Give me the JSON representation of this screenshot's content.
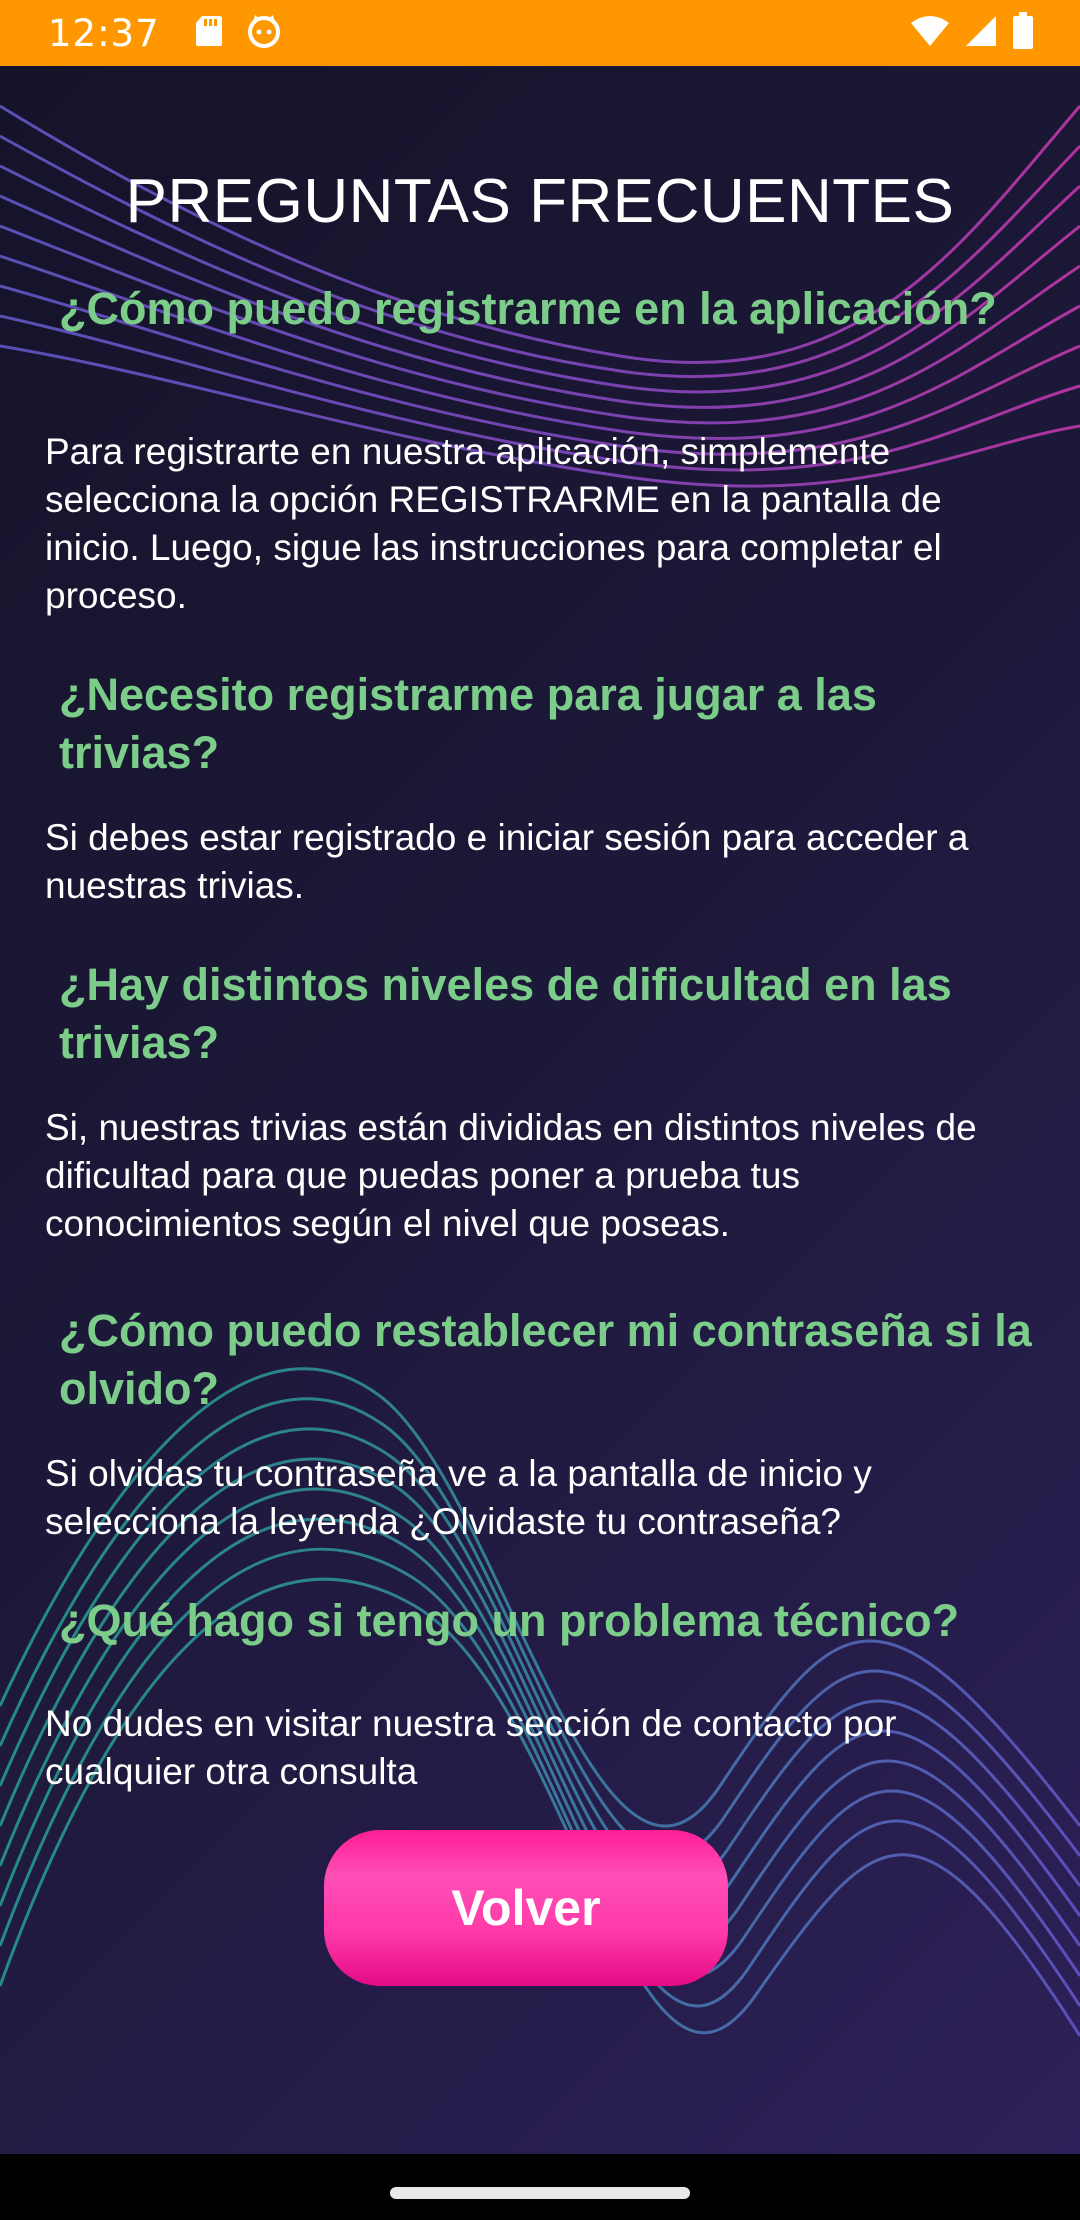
{
  "status_bar": {
    "time": "12:37",
    "icons": [
      "sd-card-icon",
      "cat-icon",
      "wifi-icon",
      "signal-icon",
      "battery-icon"
    ],
    "background_color": "#FF9800"
  },
  "page": {
    "title": "PREGUNTAS FRECUENTES"
  },
  "faq": [
    {
      "question": "¿Cómo puedo registrarme en la aplicación?",
      "answer": "Para registrarte en nuestra aplicación, simplemente selecciona la opción REGISTRARME en la pantalla de inicio. Luego, sigue las instrucciones para completar el proceso."
    },
    {
      "question": "¿Necesito registrarme para jugar a las trivias?",
      "answer": "Si debes estar registrado e iniciar sesión para acceder a nuestras trivias."
    },
    {
      "question": "¿Hay distintos niveles de dificultad en las trivias?",
      "answer": "Si, nuestras trivias están divididas en distintos niveles de dificultad para que puedas poner a prueba tus conocimientos según el nivel que poseas."
    },
    {
      "question": "¿Cómo puedo restablecer mi contraseña si la olvido?",
      "answer": "Si olvidas tu contraseña ve a la pantalla de inicio y selecciona la leyenda ¿Olvidaste tu contraseña?"
    },
    {
      "question": "¿Qué hago si tengo un problema técnico?",
      "answer": "No dudes en visitar nuestra sección de contacto por cualquier otra consulta"
    }
  ],
  "actions": {
    "back_label": "Volver"
  },
  "colors": {
    "question": "#7ccd8a",
    "answer": "#ffffff",
    "button": "#ff2a9e",
    "background_dark": "#15132a",
    "background_purple": "#2d2058"
  }
}
